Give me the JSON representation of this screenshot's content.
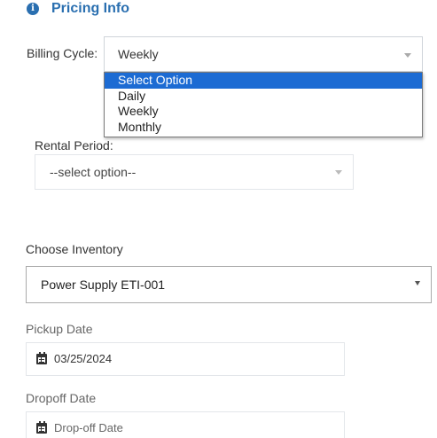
{
  "section": {
    "title": "Pricing Info",
    "icon": "info-circle-icon",
    "accent": "#2a6fb0"
  },
  "billing": {
    "label": "Billing Cycle:",
    "value": "Weekly",
    "options": [
      "Select Option",
      "Daily",
      "Weekly",
      "Monthly"
    ],
    "highlighted": "Select Option",
    "highlight_color": "#1c6bd3"
  },
  "rental": {
    "label": "Rental Period:",
    "value": "--select option--"
  },
  "inventory": {
    "label": "Choose Inventory",
    "value": "Power Supply ETI-001"
  },
  "pickup": {
    "label": "Pickup Date",
    "value": "03/25/2024",
    "icon": "calendar-icon"
  },
  "dropoff": {
    "label": "Dropoff Date",
    "placeholder": "Drop-off Date",
    "icon": "calendar-icon"
  }
}
